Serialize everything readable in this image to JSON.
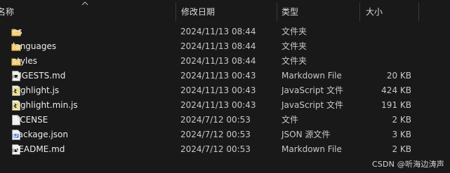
{
  "columns": {
    "name": "名称",
    "date": "修改日期",
    "type": "类型",
    "size": "大小"
  },
  "files": [
    {
      "name": "es",
      "date": "2024/11/13 08:44",
      "type": "文件夹",
      "size": "",
      "icon": "folder-icon"
    },
    {
      "name": "languages",
      "date": "2024/11/13 08:44",
      "type": "文件夹",
      "size": "",
      "icon": "folder-icon"
    },
    {
      "name": "styles",
      "date": "2024/11/13 08:44",
      "type": "文件夹",
      "size": "",
      "icon": "folder-icon"
    },
    {
      "name": "DIGESTS.md",
      "date": "2024/11/13 00:43",
      "type": "Markdown File",
      "size": "20 KB",
      "icon": "markdown-file-icon"
    },
    {
      "name": "highlight.js",
      "date": "2024/11/13 00:43",
      "type": "JavaScript 文件",
      "size": "424 KB",
      "icon": "javascript-file-icon"
    },
    {
      "name": "highlight.min.js",
      "date": "2024/11/13 00:43",
      "type": "JavaScript 文件",
      "size": "191 KB",
      "icon": "javascript-file-icon"
    },
    {
      "name": "LICENSE",
      "date": "2024/7/12 00:53",
      "type": "文件",
      "size": "2 KB",
      "icon": "blank-file-icon"
    },
    {
      "name": "package.json",
      "date": "2024/7/12 00:53",
      "type": "JSON 源文件",
      "size": "3 KB",
      "icon": "json-file-icon"
    },
    {
      "name": "README.md",
      "date": "2024/7/12 00:53",
      "type": "Markdown File",
      "size": "2 KB",
      "icon": "markdown-file-icon"
    }
  ],
  "watermark": "CSDN @听海边涛声",
  "colors": {
    "background": "#191919",
    "folder": "#e8b64c",
    "javascript_icon": "#f0db4f"
  }
}
